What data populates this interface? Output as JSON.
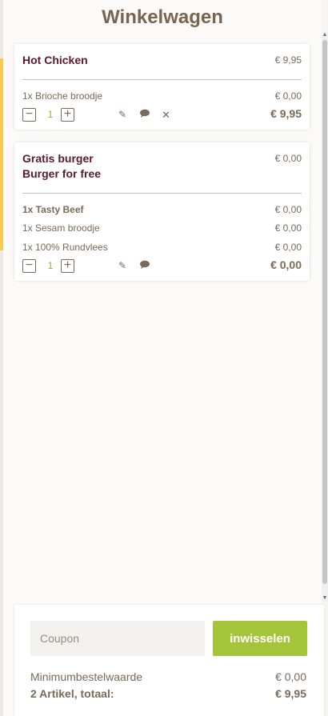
{
  "header": {
    "title": "Winkelwagen"
  },
  "cart": [
    {
      "name": "Hot Chicken",
      "price": "€ 9,95",
      "lines": [
        {
          "label": "1x Brioche broodje",
          "price": "€ 0,00",
          "bold": false
        }
      ],
      "quantity": "1",
      "total": "€ 9,95",
      "icons": [
        "pencil-icon",
        "comment-icon",
        "close-icon"
      ]
    },
    {
      "name_line1": "Gratis burger",
      "name_line2": "Burger for free",
      "price": "€ 0,00",
      "lines": [
        {
          "label": "1x Tasty Beef",
          "price": "€ 0,00",
          "bold": true
        },
        {
          "label": "1x Sesam broodje",
          "price": "€ 0,00",
          "bold": false
        },
        {
          "label": "1x 100% Rundvlees",
          "price": "€ 0,00",
          "bold": false
        }
      ],
      "quantity": "1",
      "total": "€ 0,00",
      "icons": [
        "pencil-icon",
        "comment-icon"
      ]
    }
  ],
  "footer": {
    "coupon_placeholder": "Coupon",
    "redeem_label": "inwisselen",
    "min_label": "Minimumbestelwaarde",
    "min_value": "€ 0,00",
    "total_label": "2 Artikel, totaal:",
    "total_value": "€ 9,95"
  },
  "colors": {
    "accent_green": "#a4c43a",
    "title_brown": "#7a6450",
    "item_name": "#5a1a2a",
    "side_accent": "#f5c95a"
  }
}
